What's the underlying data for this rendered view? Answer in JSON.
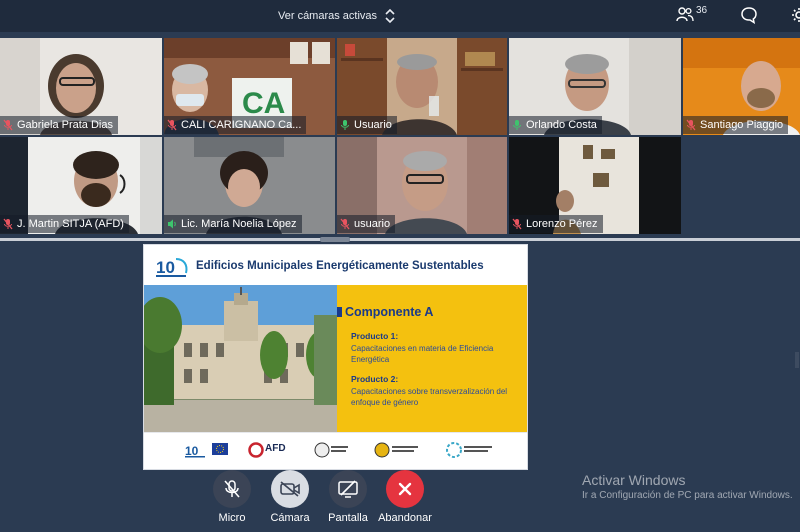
{
  "topbar": {
    "view_toggle_label": "Ver cámaras activas",
    "participant_count": "36"
  },
  "tiles": [
    {
      "name": "Gabriela Prata Dias",
      "mic": "muted"
    },
    {
      "name": "CALI CARIGNANO Ca...",
      "mic": "muted"
    },
    {
      "name": "Usuario",
      "mic": "on"
    },
    {
      "name": "Orlando Costa",
      "mic": "on"
    },
    {
      "name": "Santiago Piaggio",
      "mic": "muted"
    },
    {
      "name": "J. Martin SITJA (AFD)",
      "mic": "muted"
    },
    {
      "name": "Lic. María Noelia López",
      "mic": "speaking"
    },
    {
      "name": "usuario",
      "mic": "muted"
    },
    {
      "name": "Lorenzo Pérez",
      "mic": "muted"
    }
  ],
  "slide": {
    "title": "Edificios Municipales Energéticamente Sustentables",
    "component": "Componente A",
    "product1_title": "Producto 1:",
    "product1_text": "Capacitaciones en materia de Eficiencia Energética",
    "product2_title": "Producto 2:",
    "product2_text": "Capacitaciones sobre transverzalización del enfoque de género",
    "logo_afd": "AFD"
  },
  "controls": {
    "mic_label": "Micro",
    "camera_label": "Cámara",
    "screen_label": "Pantalla",
    "leave_label": "Abandonar"
  },
  "watermark": {
    "line1": "Activar Windows",
    "line2": "Ir a Configuración de PC para activar Windows."
  },
  "colors": {
    "background": "#2b3b52",
    "topbar": "#1f2b3d",
    "leave_button": "#e5343f",
    "control_button": "#3b4456",
    "mic_muted": "#e8545f",
    "mic_on": "#3ec46d",
    "slide_panel": "#f4c10f",
    "slide_text": "#1a3a8a"
  }
}
